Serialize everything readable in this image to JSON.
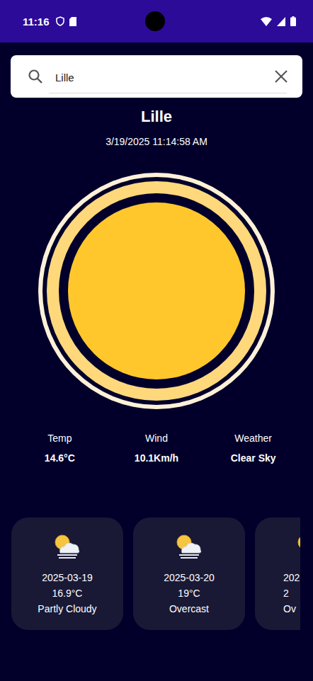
{
  "status_bar": {
    "time": "11:16"
  },
  "search": {
    "value": "Lille"
  },
  "city": "Lille",
  "datetime": "3/19/2025 11:14:58 AM",
  "stats": [
    {
      "label": "Temp",
      "value": "14.6°C"
    },
    {
      "label": "Wind",
      "value": "10.1Km/h"
    },
    {
      "label": "Weather",
      "value": "Clear Sky"
    }
  ],
  "forecast": [
    {
      "date": "2025-03-19",
      "temp": "16.9°C",
      "condition": "Partly Cloudy",
      "kind": "full"
    },
    {
      "date": "2025-03-20",
      "temp": "19°C",
      "condition": "Overcast",
      "kind": "full"
    },
    {
      "date": "202",
      "temp": "2",
      "condition": "Ov",
      "kind": "cut"
    }
  ]
}
